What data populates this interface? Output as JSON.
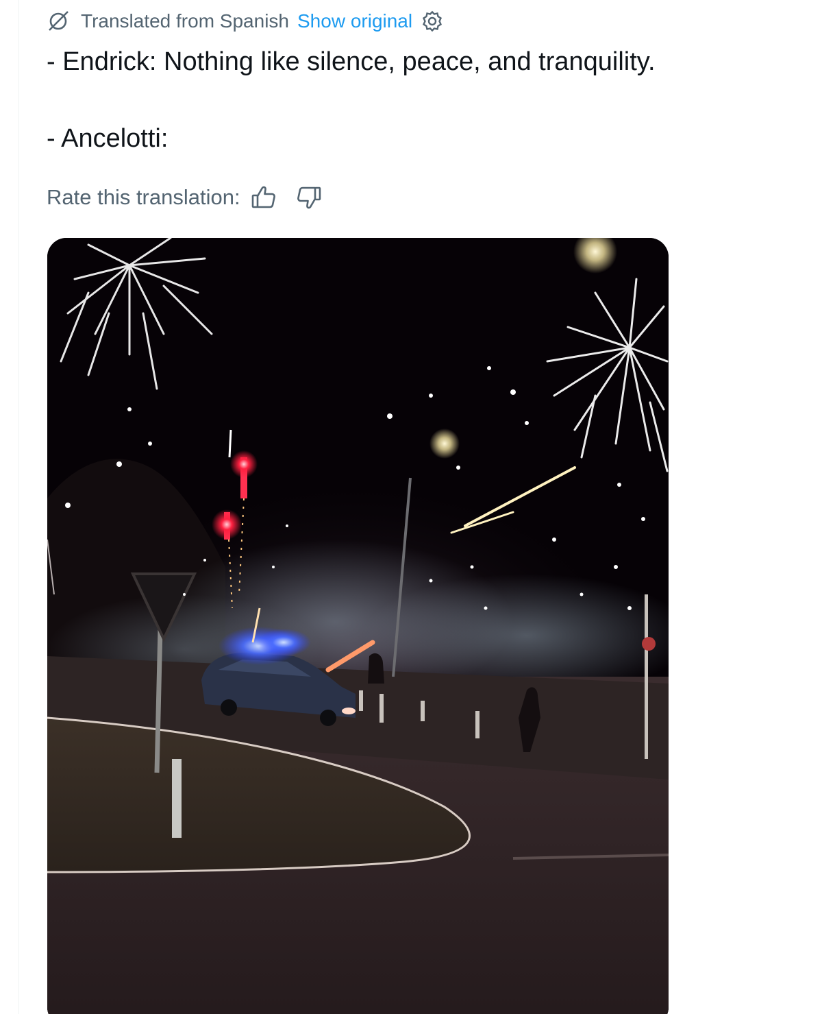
{
  "translation": {
    "label": "Translated from Spanish",
    "show_original": "Show original"
  },
  "tweet": {
    "line1": "- Endrick: Nothing like silence, peace, and tranquility.",
    "line2": "- Ancelotti:"
  },
  "rate": {
    "label": "Rate this translation:"
  },
  "icons": {
    "translate": "translate-icon",
    "settings": "gear-icon",
    "thumbs_up": "thumbs-up-icon",
    "thumbs_down": "thumbs-down-icon"
  },
  "colors": {
    "text_primary": "#0f1419",
    "text_secondary": "#536471",
    "link": "#1d9bf0"
  }
}
